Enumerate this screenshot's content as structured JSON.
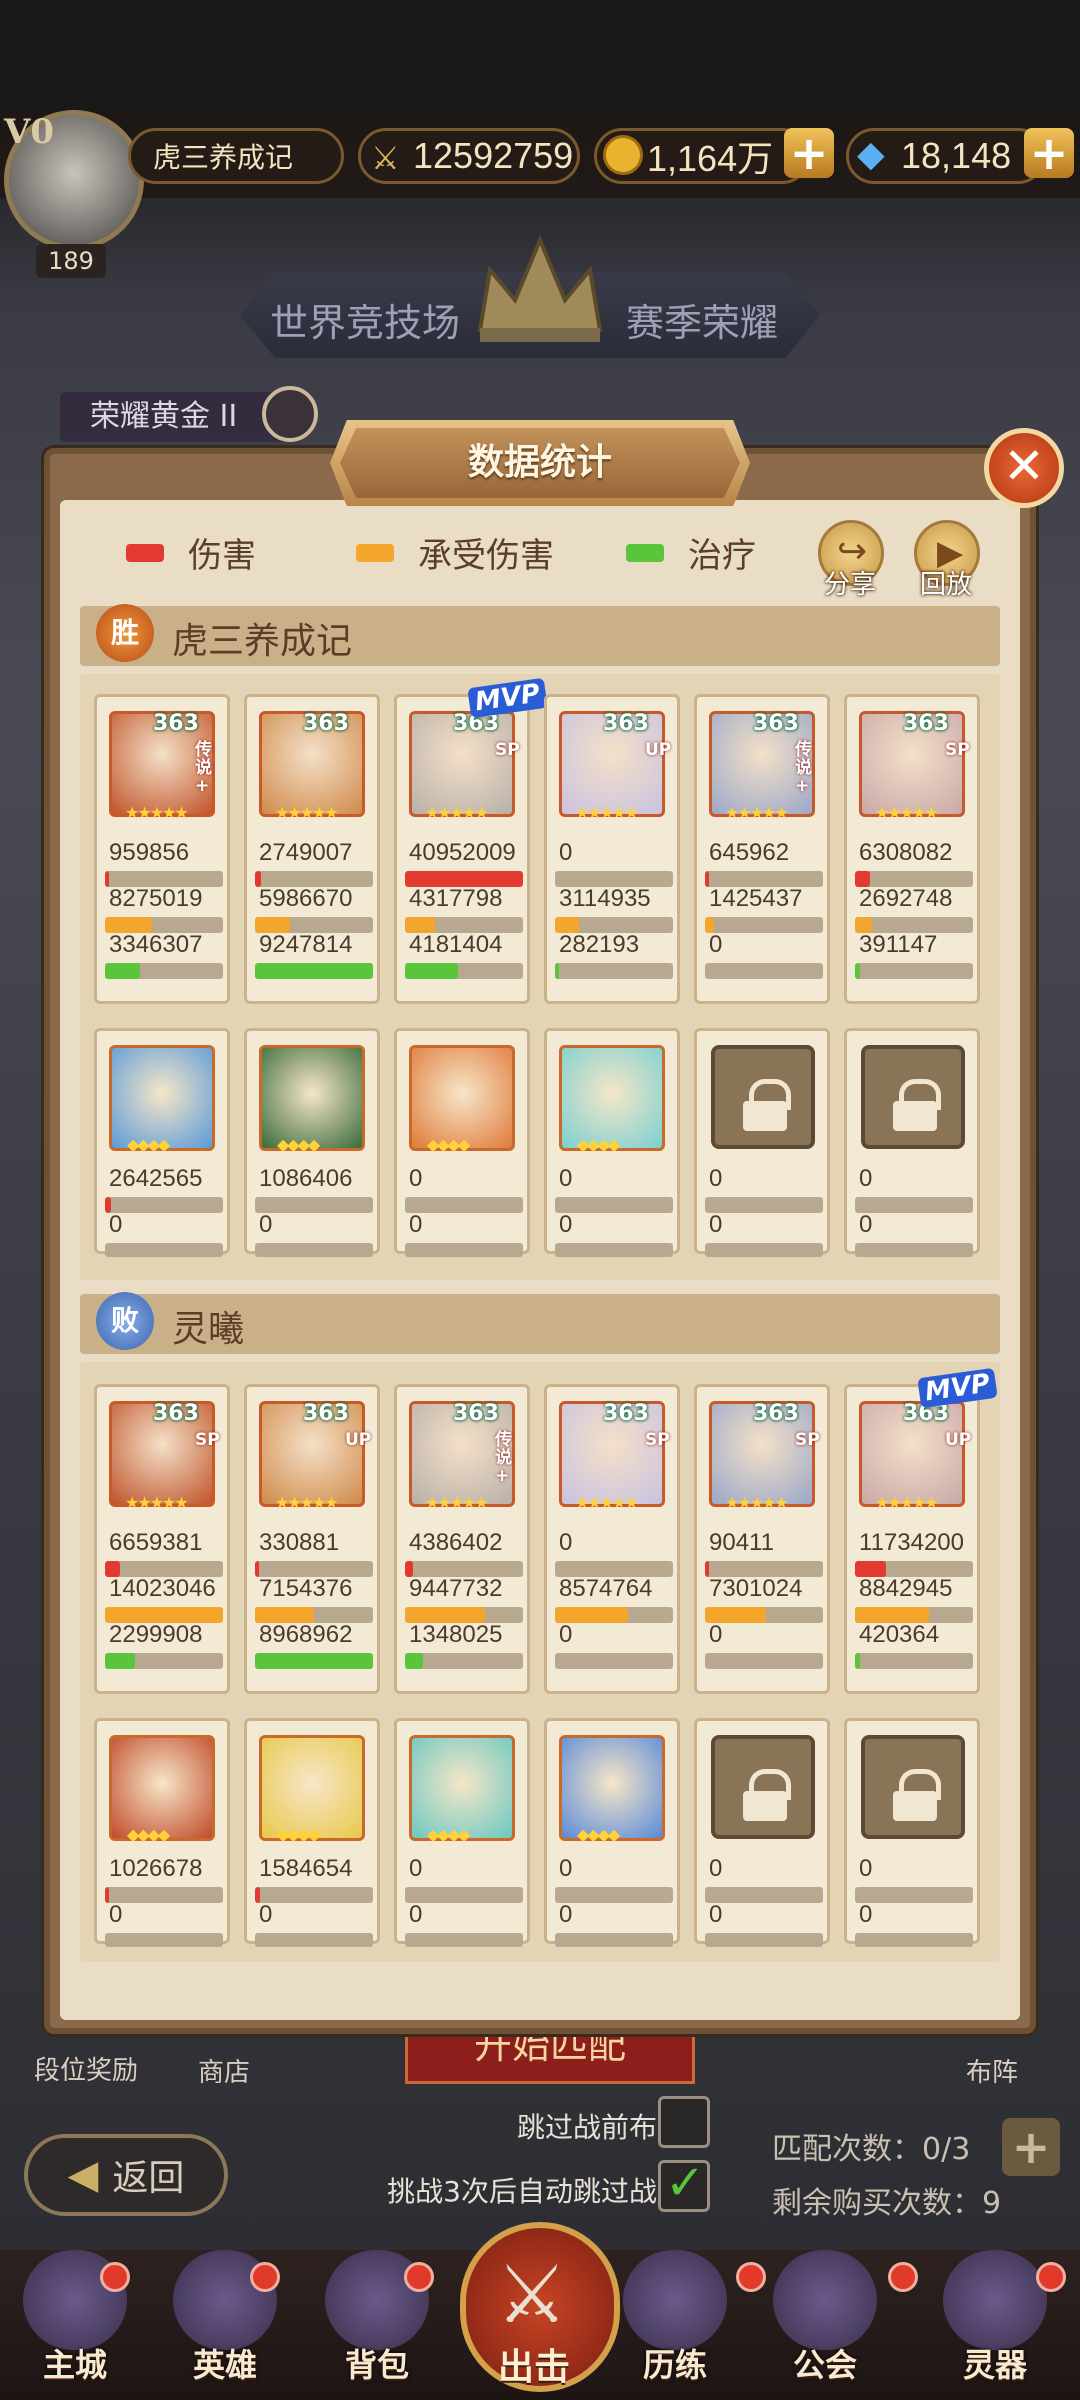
{
  "header": {
    "vip": "V0",
    "player_level": "189",
    "player_name": "虎三养成记",
    "power": "12592759",
    "gold": "1,164万",
    "gems": "18,148"
  },
  "arena": {
    "tab_world": "世界竞技场",
    "tab_season": "赛季荣耀",
    "rank": "荣耀黄金 II"
  },
  "modal": {
    "title": "数据统计",
    "legend": {
      "damage": "伤害",
      "taken": "承受伤害",
      "heal": "治疗"
    },
    "share": "分享",
    "replay": "回放",
    "mvp": "MVP",
    "colors": {
      "damage": "#e23a30",
      "taken": "#f4a62c",
      "heal": "#5ac43a"
    },
    "team_a": {
      "result": "胜",
      "name": "虎三养成记",
      "heroes": [
        {
          "level": "363",
          "tag": "传说+",
          "damage": "959856",
          "taken": "8275019",
          "heal": "3346307",
          "d": 0.02,
          "t": 0.4,
          "h": 0.3,
          "mvp": false
        },
        {
          "level": "363",
          "tag": "",
          "damage": "2749007",
          "taken": "5986670",
          "heal": "9247814",
          "d": 0.05,
          "t": 0.3,
          "h": 1.0,
          "mvp": false
        },
        {
          "level": "363",
          "tag": "SP",
          "damage": "40952009",
          "taken": "4317798",
          "heal": "4181404",
          "d": 1.0,
          "t": 0.25,
          "h": 0.45,
          "mvp": true
        },
        {
          "level": "363",
          "tag": "UP",
          "damage": "0",
          "taken": "3114935",
          "heal": "282193",
          "d": 0,
          "t": 0.2,
          "h": 0.03,
          "mvp": false
        },
        {
          "level": "363",
          "tag": "传说+",
          "damage": "645962",
          "taken": "1425437",
          "heal": "0",
          "d": 0.02,
          "t": 0.08,
          "h": 0,
          "mvp": false
        },
        {
          "level": "363",
          "tag": "SP",
          "damage": "6308082",
          "taken": "2692748",
          "heal": "391147",
          "d": 0.13,
          "t": 0.14,
          "h": 0.04,
          "mvp": false
        }
      ],
      "pets": [
        {
          "damage": "2642565",
          "taken": "0",
          "d": 0.05,
          "locked": false
        },
        {
          "damage": "1086406",
          "taken": "0",
          "d": 0,
          "locked": false
        },
        {
          "damage": "0",
          "taken": "0",
          "d": 0,
          "locked": false
        },
        {
          "damage": "0",
          "taken": "0",
          "d": 0,
          "locked": false
        },
        {
          "damage": "0",
          "taken": "0",
          "d": 0,
          "locked": true
        },
        {
          "damage": "0",
          "taken": "0",
          "d": 0,
          "locked": true
        }
      ]
    },
    "team_b": {
      "result": "败",
      "name": "灵曦",
      "heroes": [
        {
          "level": "363",
          "tag": "SP",
          "damage": "6659381",
          "taken": "14023046",
          "heal": "2299908",
          "d": 0.13,
          "t": 1.0,
          "h": 0.25,
          "mvp": false
        },
        {
          "level": "363",
          "tag": "UP",
          "damage": "330881",
          "taken": "7154376",
          "heal": "8968962",
          "d": 0.01,
          "t": 0.5,
          "h": 1.0,
          "mvp": false
        },
        {
          "level": "363",
          "tag": "传说+",
          "damage": "4386402",
          "taken": "9447732",
          "heal": "1348025",
          "d": 0.07,
          "t": 0.68,
          "h": 0.15,
          "mvp": false
        },
        {
          "level": "363",
          "tag": "SP",
          "damage": "0",
          "taken": "8574764",
          "heal": "0",
          "d": 0,
          "t": 0.62,
          "h": 0,
          "mvp": false
        },
        {
          "level": "363",
          "tag": "SP",
          "damage": "90411",
          "taken": "7301024",
          "heal": "0",
          "d": 0.01,
          "t": 0.52,
          "h": 0,
          "mvp": false
        },
        {
          "level": "363",
          "tag": "UP",
          "damage": "11734200",
          "taken": "8842945",
          "heal": "420364",
          "d": 0.26,
          "t": 0.63,
          "h": 0.04,
          "mvp": true
        }
      ],
      "pets": [
        {
          "damage": "1026678",
          "taken": "0",
          "d": 0.02,
          "locked": false
        },
        {
          "damage": "1584654",
          "taken": "0",
          "d": 0.04,
          "locked": false
        },
        {
          "damage": "0",
          "taken": "0",
          "d": 0,
          "locked": false
        },
        {
          "damage": "0",
          "taken": "0",
          "d": 0,
          "locked": false
        },
        {
          "damage": "0",
          "taken": "0",
          "d": 0,
          "locked": true
        },
        {
          "damage": "0",
          "taken": "0",
          "d": 0,
          "locked": true
        }
      ]
    }
  },
  "bottom": {
    "rank_reward": "段位奖励",
    "shop": "商店",
    "formation": "布阵",
    "start_match": "开始匹配",
    "skip_formation": "跳过战前布阵",
    "auto_skip": "挑战3次后自动跳过战斗",
    "back": "返回",
    "match_count": "匹配次数：0/3",
    "remain_buy": "剩余购买次数：9"
  },
  "nav": [
    "主城",
    "英雄",
    "背包",
    "出击",
    "历练",
    "公会",
    "灵器"
  ]
}
